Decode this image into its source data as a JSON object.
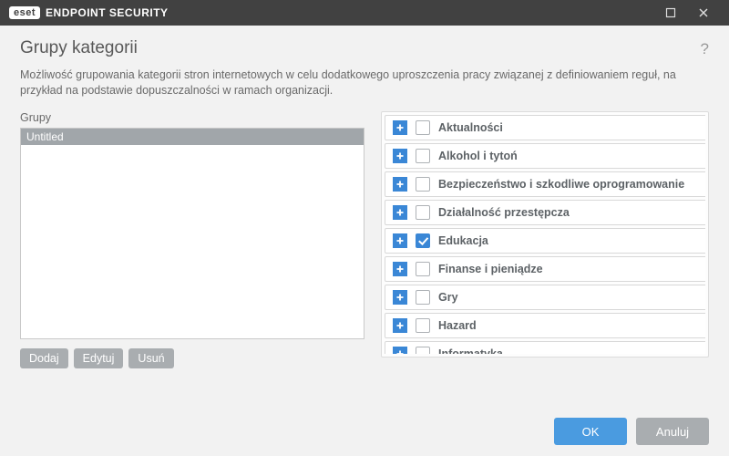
{
  "titlebar": {
    "brand_pill": "eset",
    "brand_rest": "ENDPOINT SECURITY"
  },
  "page": {
    "title": "Grupy kategorii",
    "description": "Możliwość grupowania kategorii stron internetowych w celu dodatkowego uproszczenia pracy związanej z definiowaniem reguł, na przykład na podstawie dopuszczalności w ramach organizacji.",
    "groups_label": "Grupy"
  },
  "groups": [
    {
      "name": "Untitled",
      "selected": true
    }
  ],
  "group_buttons": {
    "add": "Dodaj",
    "edit": "Edytuj",
    "remove": "Usuń"
  },
  "categories": [
    {
      "name": "Aktualności",
      "checked": false
    },
    {
      "name": "Alkohol i tytoń",
      "checked": false
    },
    {
      "name": "Bezpieczeństwo i szkodliwe oprogramowanie",
      "checked": false
    },
    {
      "name": "Działalność przestępcza",
      "checked": false
    },
    {
      "name": "Edukacja",
      "checked": true
    },
    {
      "name": "Finanse i pieniądze",
      "checked": false
    },
    {
      "name": "Gry",
      "checked": false
    },
    {
      "name": "Hazard",
      "checked": false
    },
    {
      "name": "Informatyka",
      "checked": false
    }
  ],
  "footer": {
    "ok": "OK",
    "cancel": "Anuluj"
  }
}
